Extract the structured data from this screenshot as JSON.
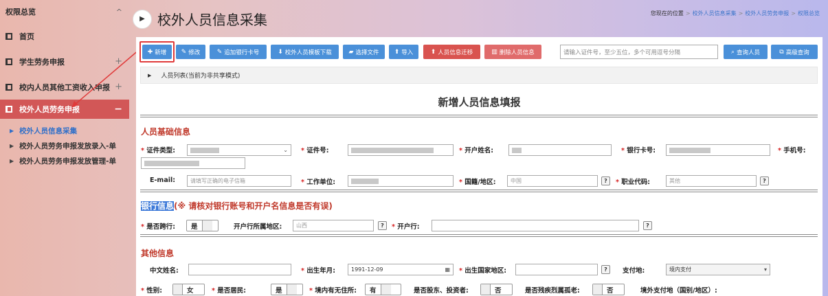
{
  "sidebar": {
    "header": "权限总览",
    "header_icon": "^",
    "items": [
      {
        "label": "首页",
        "expander": ""
      },
      {
        "label": "学生劳务申报",
        "expander": "+"
      },
      {
        "label": "校内人员其他工资收入申报",
        "expander": "+"
      },
      {
        "label": "校外人员劳务申报",
        "expander": "−"
      }
    ],
    "subitems": [
      {
        "label": "校外人员信息采集"
      },
      {
        "label": "校外人员劳务申报发放录入-单"
      },
      {
        "label": "校外人员劳务申报发放管理-单"
      }
    ]
  },
  "header": {
    "title": "校外人员信息采集",
    "breadcrumb_prefix": "您现在的位置",
    "breadcrumb": [
      "校外人员信息采集",
      "校外人员劳务申报",
      "权限总览"
    ]
  },
  "toolbar": {
    "add": "新增",
    "edit": "修改",
    "add_bank_card": "追加银行卡号",
    "download_template": "校外人员模板下载",
    "choose_file": "选择文件",
    "import": "导入",
    "migrate": "人员信息迁移",
    "delete": "删除人员信息",
    "search_placeholder": "请输入证件号，至少五位，多个可用逗号分隔",
    "query": "查询人员",
    "advanced": "高级查询"
  },
  "list_bar": "人员列表(当前为非共享模式)",
  "form": {
    "title": "新增人员信息填报",
    "basic_section": "人员基础信息",
    "id_type": "证件类型:",
    "id_no": "证件号:",
    "account_name": "开户姓名:",
    "bank_card": "银行卡号:",
    "phone": "手机号:",
    "email": "E-mail:",
    "email_placeholder": "请填写正确的电子信箱",
    "workplace": "工作单位:",
    "nationality": "国籍/地区:",
    "nationality_value": "中国",
    "occupation": "职业代码:",
    "occupation_value": "其他",
    "bank_section_hl": "银行信息",
    "bank_section_note": "(※ 请核对银行账号和开户名信息是否有误)",
    "cross_bank": "是否跨行:",
    "cross_bank_value": "是",
    "bank_region": "开户行所属地区:",
    "bank_region_value": "山西",
    "bank_branch": "开户行:",
    "other_section": "其他信息",
    "cn_name": "中文姓名:",
    "birth": "出生年月:",
    "birth_value": "1991-12-09",
    "birth_country": "出生国家地区:",
    "pay_place": "支付地:",
    "pay_place_value": "境内支付",
    "gender": "性别:",
    "gender_value": "女",
    "resident": "是否居民:",
    "resident_value": "是",
    "domicile": "境内有无住所:",
    "domicile_value": "有",
    "shareholder": "是否股东、投资者:",
    "shareholder_value": "否",
    "disabled": "是否残疾烈属孤老:",
    "disabled_value": "否",
    "overseas_pay": "境外支付地（国别/地区）:"
  }
}
